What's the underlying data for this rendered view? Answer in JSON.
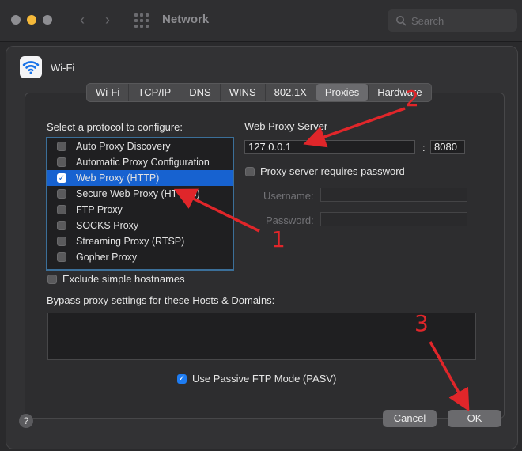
{
  "window": {
    "title": "Network",
    "search_placeholder": "Search"
  },
  "sheet": {
    "interface_name": "Wi-Fi",
    "tabs": [
      {
        "label": "Wi-Fi"
      },
      {
        "label": "TCP/IP"
      },
      {
        "label": "DNS"
      },
      {
        "label": "WINS"
      },
      {
        "label": "802.1X"
      },
      {
        "label": "Proxies",
        "active": true
      },
      {
        "label": "Hardware"
      }
    ],
    "protocol_heading": "Select a protocol to configure:",
    "protocols": [
      {
        "label": "Auto Proxy Discovery",
        "checked": false,
        "selected": false
      },
      {
        "label": "Automatic Proxy Configuration",
        "checked": false,
        "selected": false
      },
      {
        "label": "Web Proxy (HTTP)",
        "checked": true,
        "selected": true
      },
      {
        "label": "Secure Web Proxy (HTTPS)",
        "checked": false,
        "selected": false
      },
      {
        "label": "FTP Proxy",
        "checked": false,
        "selected": false
      },
      {
        "label": "SOCKS Proxy",
        "checked": false,
        "selected": false
      },
      {
        "label": "Streaming Proxy (RTSP)",
        "checked": false,
        "selected": false
      },
      {
        "label": "Gopher Proxy",
        "checked": false,
        "selected": false
      }
    ],
    "server": {
      "heading": "Web Proxy Server",
      "address": "127.0.0.1",
      "colon": ":",
      "port": "8080",
      "requires_password_label": "Proxy server requires password",
      "username_label": "Username:",
      "password_label": "Password:"
    },
    "exclude_simple_hostnames": "Exclude simple hostnames",
    "bypass_heading": "Bypass proxy settings for these Hosts & Domains:",
    "passive_ftp_label": "Use Passive FTP Mode (PASV)",
    "buttons": {
      "help": "?",
      "cancel": "Cancel",
      "ok": "OK"
    }
  },
  "annotations": {
    "color": "#e0262a",
    "numbers": [
      "1",
      "2",
      "3"
    ]
  }
}
